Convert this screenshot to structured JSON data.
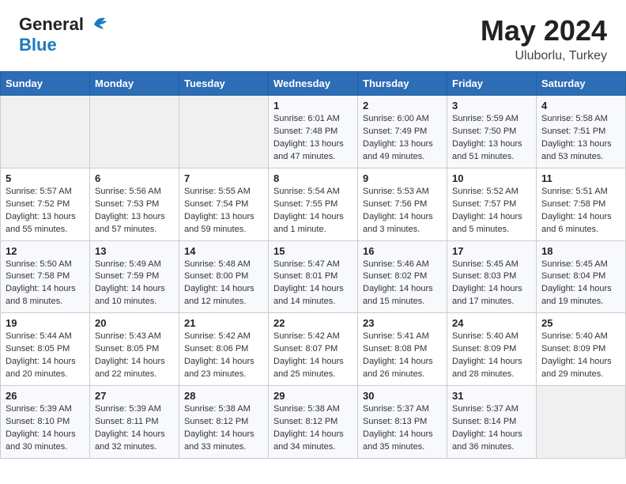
{
  "header": {
    "logo_general": "General",
    "logo_blue": "Blue",
    "month_title": "May 2024",
    "location": "Uluborlu, Turkey"
  },
  "weekdays": [
    "Sunday",
    "Monday",
    "Tuesday",
    "Wednesday",
    "Thursday",
    "Friday",
    "Saturday"
  ],
  "weeks": [
    [
      {
        "day": "",
        "info": ""
      },
      {
        "day": "",
        "info": ""
      },
      {
        "day": "",
        "info": ""
      },
      {
        "day": "1",
        "info": "Sunrise: 6:01 AM\nSunset: 7:48 PM\nDaylight: 13 hours\nand 47 minutes."
      },
      {
        "day": "2",
        "info": "Sunrise: 6:00 AM\nSunset: 7:49 PM\nDaylight: 13 hours\nand 49 minutes."
      },
      {
        "day": "3",
        "info": "Sunrise: 5:59 AM\nSunset: 7:50 PM\nDaylight: 13 hours\nand 51 minutes."
      },
      {
        "day": "4",
        "info": "Sunrise: 5:58 AM\nSunset: 7:51 PM\nDaylight: 13 hours\nand 53 minutes."
      }
    ],
    [
      {
        "day": "5",
        "info": "Sunrise: 5:57 AM\nSunset: 7:52 PM\nDaylight: 13 hours\nand 55 minutes."
      },
      {
        "day": "6",
        "info": "Sunrise: 5:56 AM\nSunset: 7:53 PM\nDaylight: 13 hours\nand 57 minutes."
      },
      {
        "day": "7",
        "info": "Sunrise: 5:55 AM\nSunset: 7:54 PM\nDaylight: 13 hours\nand 59 minutes."
      },
      {
        "day": "8",
        "info": "Sunrise: 5:54 AM\nSunset: 7:55 PM\nDaylight: 14 hours\nand 1 minute."
      },
      {
        "day": "9",
        "info": "Sunrise: 5:53 AM\nSunset: 7:56 PM\nDaylight: 14 hours\nand 3 minutes."
      },
      {
        "day": "10",
        "info": "Sunrise: 5:52 AM\nSunset: 7:57 PM\nDaylight: 14 hours\nand 5 minutes."
      },
      {
        "day": "11",
        "info": "Sunrise: 5:51 AM\nSunset: 7:58 PM\nDaylight: 14 hours\nand 6 minutes."
      }
    ],
    [
      {
        "day": "12",
        "info": "Sunrise: 5:50 AM\nSunset: 7:58 PM\nDaylight: 14 hours\nand 8 minutes."
      },
      {
        "day": "13",
        "info": "Sunrise: 5:49 AM\nSunset: 7:59 PM\nDaylight: 14 hours\nand 10 minutes."
      },
      {
        "day": "14",
        "info": "Sunrise: 5:48 AM\nSunset: 8:00 PM\nDaylight: 14 hours\nand 12 minutes."
      },
      {
        "day": "15",
        "info": "Sunrise: 5:47 AM\nSunset: 8:01 PM\nDaylight: 14 hours\nand 14 minutes."
      },
      {
        "day": "16",
        "info": "Sunrise: 5:46 AM\nSunset: 8:02 PM\nDaylight: 14 hours\nand 15 minutes."
      },
      {
        "day": "17",
        "info": "Sunrise: 5:45 AM\nSunset: 8:03 PM\nDaylight: 14 hours\nand 17 minutes."
      },
      {
        "day": "18",
        "info": "Sunrise: 5:45 AM\nSunset: 8:04 PM\nDaylight: 14 hours\nand 19 minutes."
      }
    ],
    [
      {
        "day": "19",
        "info": "Sunrise: 5:44 AM\nSunset: 8:05 PM\nDaylight: 14 hours\nand 20 minutes."
      },
      {
        "day": "20",
        "info": "Sunrise: 5:43 AM\nSunset: 8:05 PM\nDaylight: 14 hours\nand 22 minutes."
      },
      {
        "day": "21",
        "info": "Sunrise: 5:42 AM\nSunset: 8:06 PM\nDaylight: 14 hours\nand 23 minutes."
      },
      {
        "day": "22",
        "info": "Sunrise: 5:42 AM\nSunset: 8:07 PM\nDaylight: 14 hours\nand 25 minutes."
      },
      {
        "day": "23",
        "info": "Sunrise: 5:41 AM\nSunset: 8:08 PM\nDaylight: 14 hours\nand 26 minutes."
      },
      {
        "day": "24",
        "info": "Sunrise: 5:40 AM\nSunset: 8:09 PM\nDaylight: 14 hours\nand 28 minutes."
      },
      {
        "day": "25",
        "info": "Sunrise: 5:40 AM\nSunset: 8:09 PM\nDaylight: 14 hours\nand 29 minutes."
      }
    ],
    [
      {
        "day": "26",
        "info": "Sunrise: 5:39 AM\nSunset: 8:10 PM\nDaylight: 14 hours\nand 30 minutes."
      },
      {
        "day": "27",
        "info": "Sunrise: 5:39 AM\nSunset: 8:11 PM\nDaylight: 14 hours\nand 32 minutes."
      },
      {
        "day": "28",
        "info": "Sunrise: 5:38 AM\nSunset: 8:12 PM\nDaylight: 14 hours\nand 33 minutes."
      },
      {
        "day": "29",
        "info": "Sunrise: 5:38 AM\nSunset: 8:12 PM\nDaylight: 14 hours\nand 34 minutes."
      },
      {
        "day": "30",
        "info": "Sunrise: 5:37 AM\nSunset: 8:13 PM\nDaylight: 14 hours\nand 35 minutes."
      },
      {
        "day": "31",
        "info": "Sunrise: 5:37 AM\nSunset: 8:14 PM\nDaylight: 14 hours\nand 36 minutes."
      },
      {
        "day": "",
        "info": ""
      }
    ]
  ]
}
